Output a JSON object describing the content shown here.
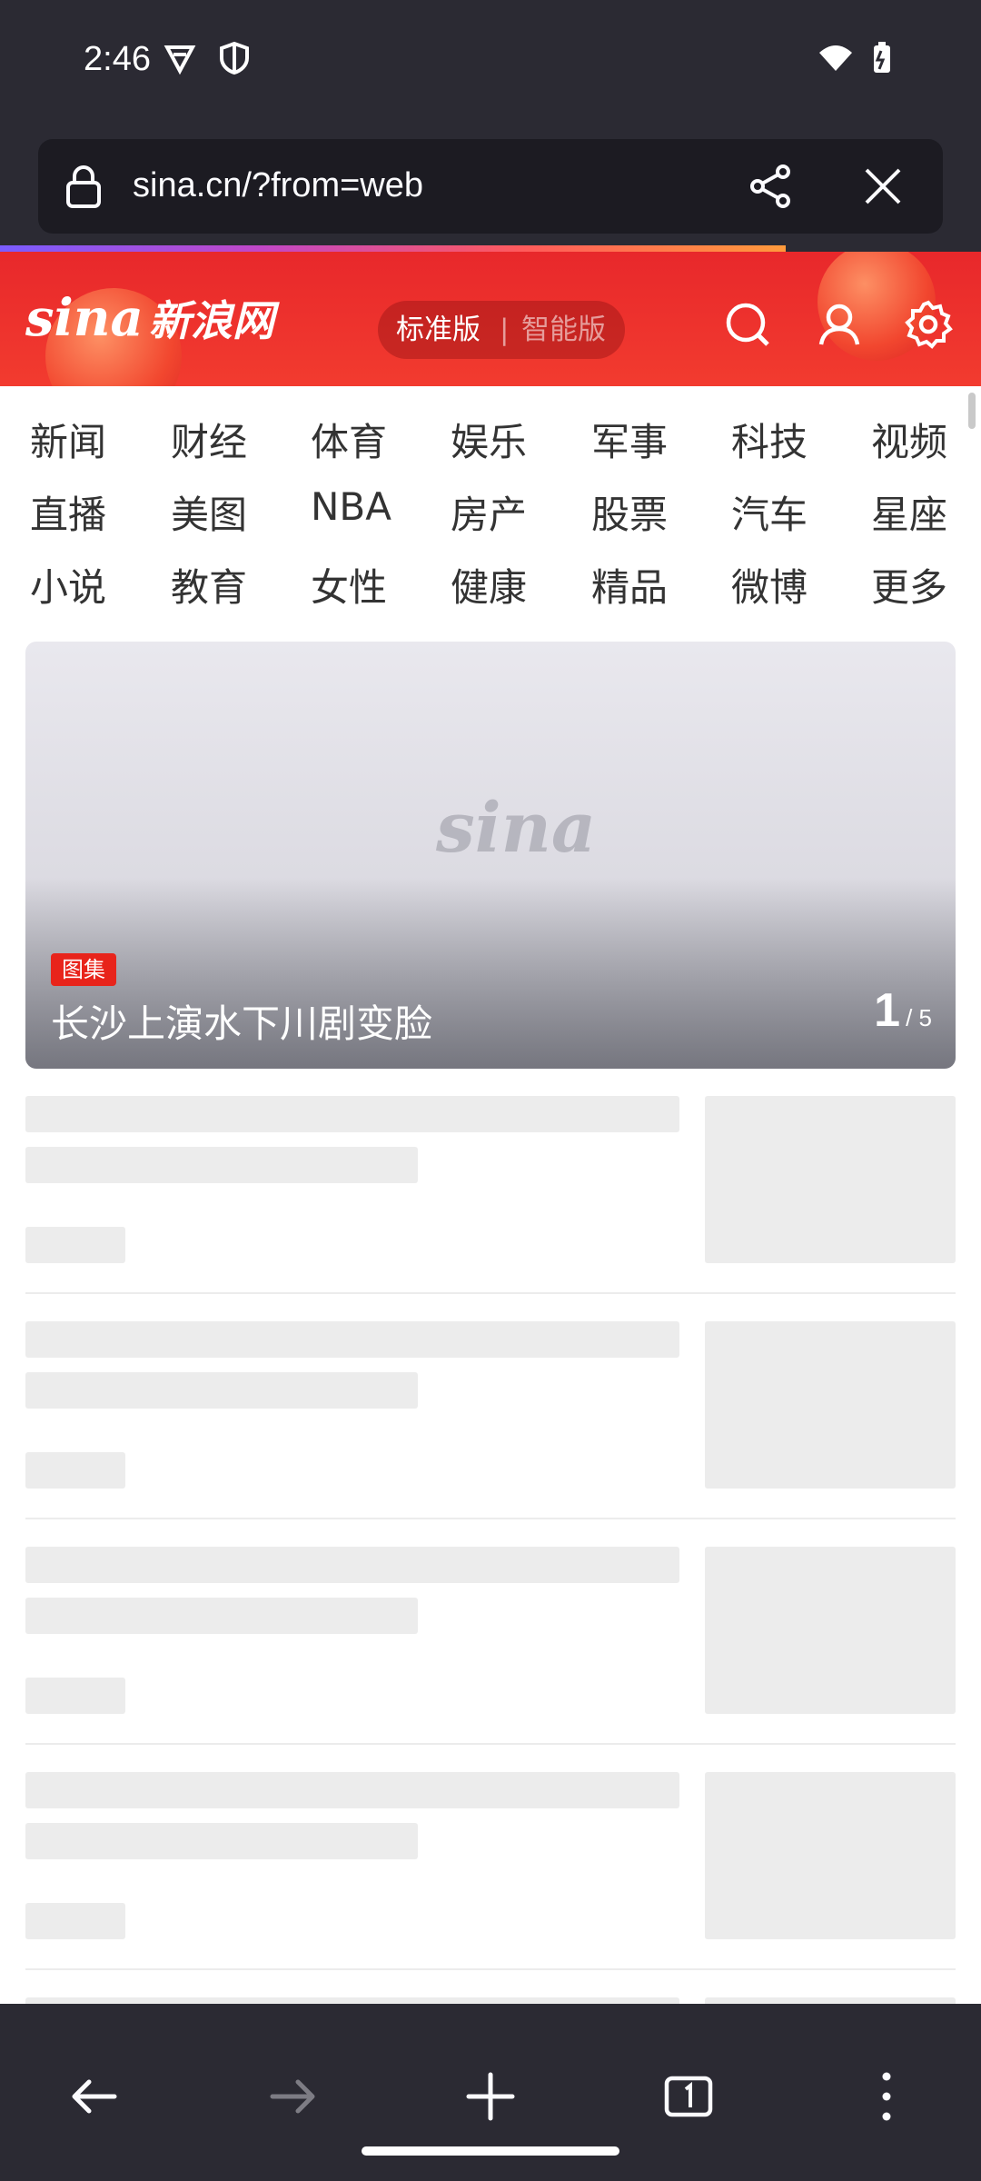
{
  "status_bar": {
    "time": "2:46"
  },
  "browser": {
    "url": "sina.cn/?from=web",
    "progress": 0.8
  },
  "sina": {
    "logo_en": "sina",
    "logo_cn": "新浪网",
    "version_standard": "标准版",
    "version_separator": "|",
    "version_smart": "智能版"
  },
  "nav": {
    "rows": [
      [
        "新闻",
        "财经",
        "体育",
        "娱乐",
        "军事",
        "科技",
        "视频"
      ],
      [
        "直播",
        "美图",
        "NBA",
        "房产",
        "股票",
        "汽车",
        "星座"
      ],
      [
        "小说",
        "教育",
        "女性",
        "健康",
        "精品",
        "微博",
        "更多"
      ]
    ]
  },
  "hero": {
    "tag": "图集",
    "title": "长沙上演水下川剧变脸",
    "watermark": "sina",
    "page_current": "1",
    "page_total": "/ 5"
  },
  "colors": {
    "brand_red": "#e8282b",
    "chrome_dark": "#2b2a33",
    "skeleton": "#ececec"
  },
  "icons": [
    "lock-icon",
    "share-icon",
    "close-icon",
    "search-icon",
    "user-icon",
    "settings-icon",
    "back-icon",
    "forward-icon",
    "new-tab-icon",
    "tabs-icon",
    "menu-icon"
  ]
}
